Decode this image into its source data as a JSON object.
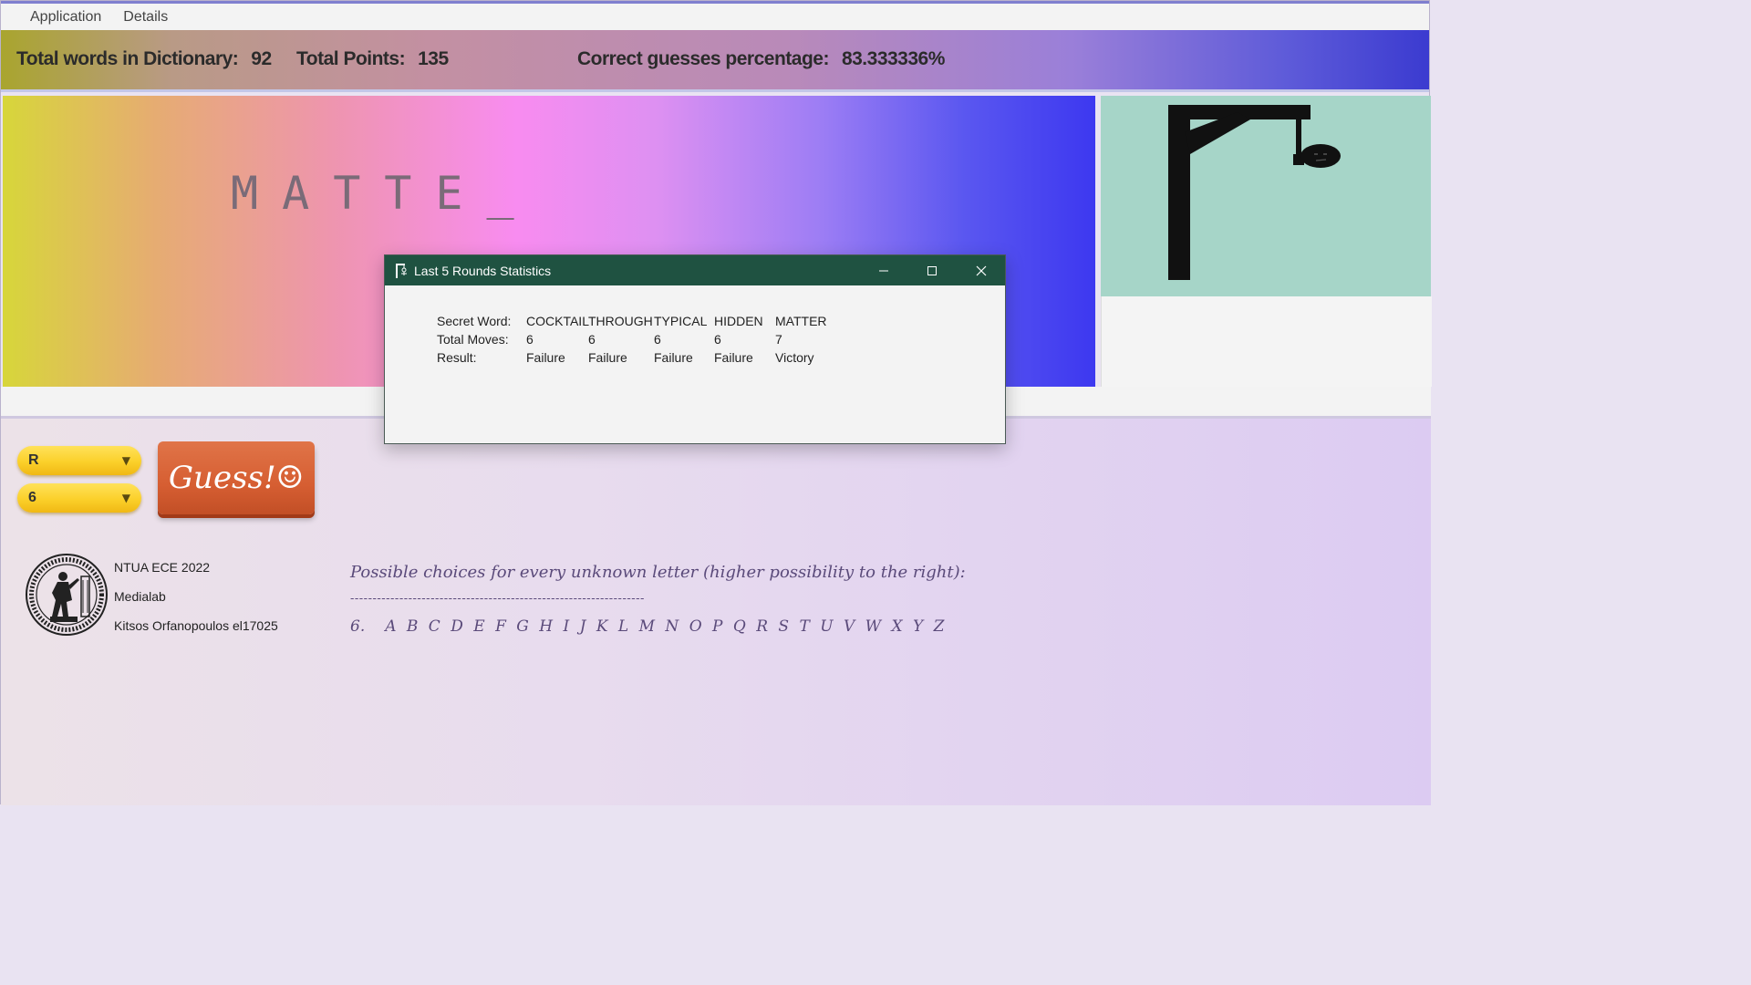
{
  "menubar": {
    "items": [
      "Application",
      "Details"
    ]
  },
  "stats": {
    "dict_label": "Total words in Dictionary:",
    "dict_value": "92",
    "points_label": "Total Points:",
    "points_value": "135",
    "pct_label": "Correct guesses percentage:",
    "pct_value": "83.333336%"
  },
  "word_display": "MATTE_",
  "controls": {
    "letter_combo": "R",
    "position_combo": "6",
    "guess_label": "Guess!☺"
  },
  "credits": {
    "line1": "NTUA ECE 2022",
    "line2": "Medialab",
    "line3": "Kitsos Orfanopoulos el17025"
  },
  "hints": {
    "title": "Possible choices for every unknown letter (higher possibility to the right):",
    "divider": "------------------------------------------------------------------",
    "row_number": "6.",
    "row_letters": "A B C D E F G H I J K L M N O P Q R S T U V W X Y Z"
  },
  "dialog": {
    "title": "Last 5 Rounds Statistics",
    "rows": {
      "secret_label": "Secret Word:",
      "secret": [
        "COCKTAIL",
        "THROUGH",
        "TYPICAL",
        "HIDDEN",
        "MATTER"
      ],
      "moves_label": "Total Moves:",
      "moves": [
        "6",
        "6",
        "6",
        "6",
        "7"
      ],
      "result_label": "Result:",
      "result": [
        "Failure",
        "Failure",
        "Failure",
        "Failure",
        "Victory"
      ]
    }
  },
  "colors": {
    "dialog_titlebar": "#1f5241",
    "guess_button": "#d65e32",
    "combo": "#fbd02a",
    "gallows_bg": "#a6d5c8"
  }
}
